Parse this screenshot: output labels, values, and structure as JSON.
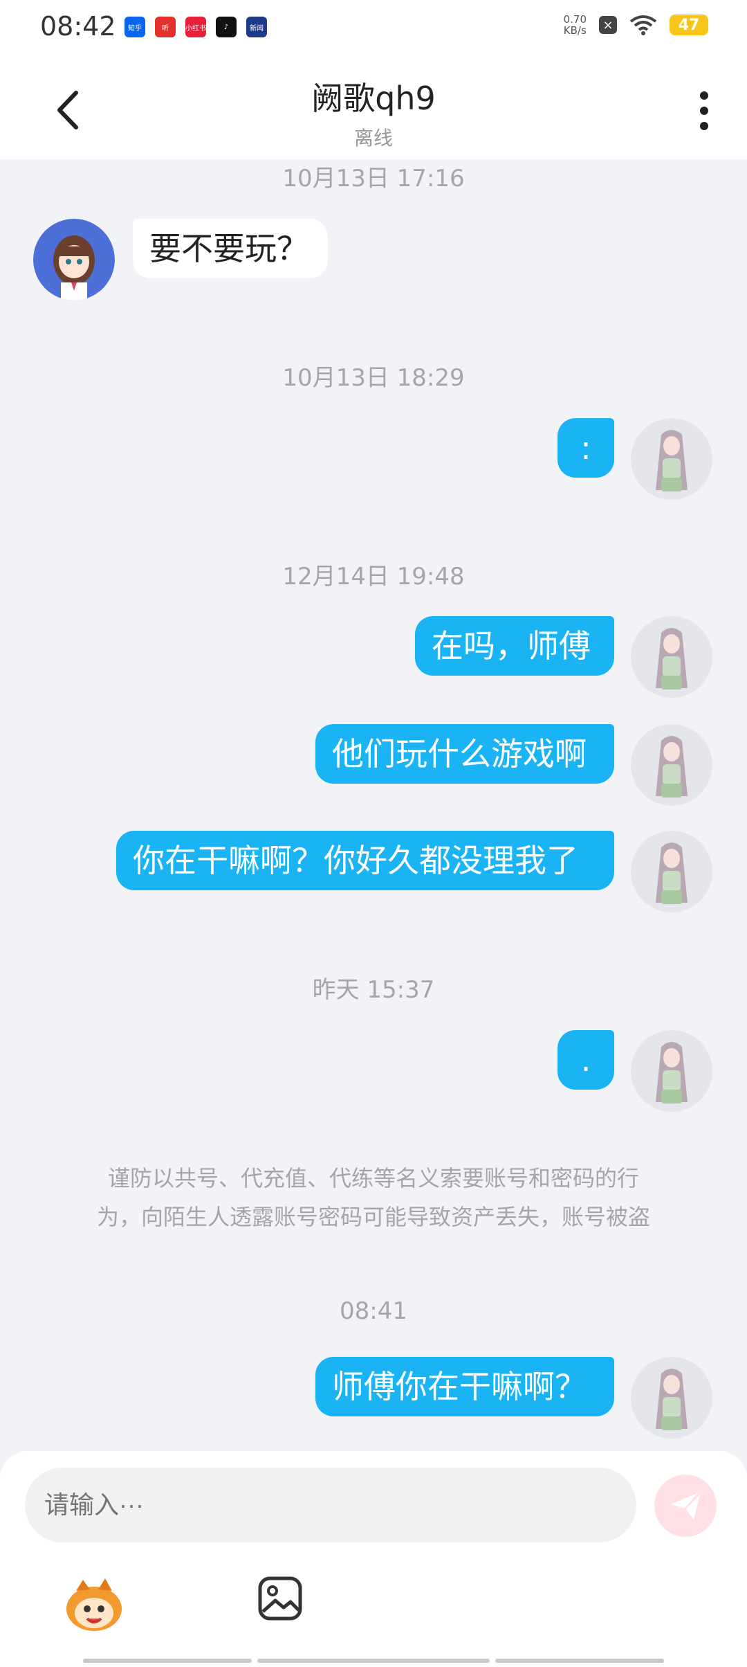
{
  "status_bar": {
    "time": "08:42",
    "net_speed_value": "0.70",
    "net_speed_unit": "KB/s",
    "battery": "47",
    "app_icons": [
      {
        "name": "zhihu-icon",
        "label": "知乎",
        "color": "#0a66f0"
      },
      {
        "name": "listen-icon",
        "label": "听",
        "color": "#e6302e"
      },
      {
        "name": "xiaohongshu-icon",
        "label": "小红书",
        "color": "#ea1f39"
      },
      {
        "name": "tiktok-icon",
        "label": "♪",
        "color": "#111111"
      },
      {
        "name": "news-icon",
        "label": "新闻",
        "color": "#1e3a8a"
      }
    ]
  },
  "header": {
    "title": "阙歌qh9",
    "subtitle": "离线"
  },
  "messages": {
    "ts1": "10月13日 17:16",
    "in1": "要不要玩？",
    "ts2": "10月13日 18:29",
    "out1": ":",
    "ts3": "12月14日 19:48",
    "out2": "在吗，师傅",
    "out3": "他们玩什么游戏啊",
    "out4": "你在干嘛啊？你好久都没理我了",
    "ts4": "昨天 15:37",
    "out5": ".",
    "notice_line1": "谨防以共号、代充值、代练等名义索要账号和密码的行",
    "notice_line2": "为，向陌生人透露账号密码可能导致资产丢失，账号被盗",
    "ts5": "08:41",
    "out6": "师傅你在干嘛啊？"
  },
  "composer": {
    "placeholder": "请输入···"
  },
  "colors": {
    "bubble_out": "#1ab4f5",
    "bubble_in": "#ffffff",
    "chat_bg": "#f1f3f7",
    "send_disabled": "#ffe0e4"
  }
}
